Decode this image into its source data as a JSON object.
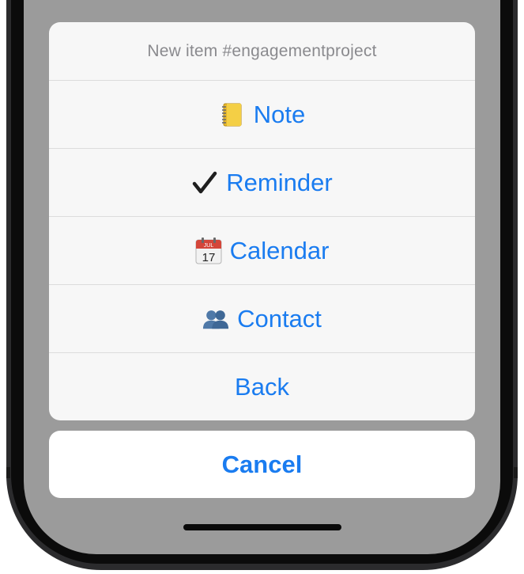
{
  "sheet": {
    "title": "New item #engagementproject",
    "actions": [
      {
        "label": "Note",
        "icon": "notebook-icon"
      },
      {
        "label": "Reminder",
        "icon": "checkmark-icon"
      },
      {
        "label": "Calendar",
        "icon": "calendar-icon"
      },
      {
        "label": "Contact",
        "icon": "contacts-icon"
      },
      {
        "label": "Back",
        "icon": ""
      }
    ],
    "cancel_label": "Cancel",
    "calendar_month": "JUL",
    "calendar_day": "17"
  },
  "colors": {
    "accent": "#1a7cf0",
    "title_gray": "#8a8a8e",
    "sheet_bg": "#f7f7f7",
    "dim_overlay": "#9b9b9b"
  }
}
